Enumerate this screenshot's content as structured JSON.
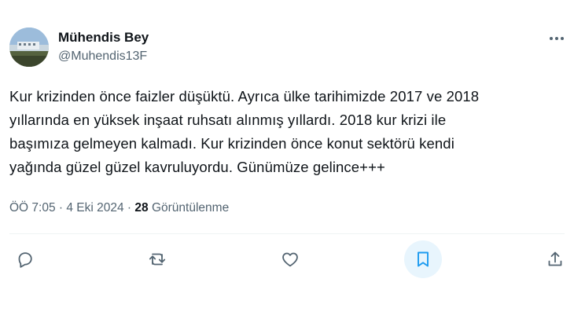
{
  "author": {
    "display_name": "Mühendis Bey",
    "handle": "@Muhendis13F"
  },
  "tweet": {
    "lines": [
      "Kur krizinden önce faizler düşüktü. Ayrıca ülke tarihimizde 2017 ve 2018",
      "yıllarında en yüksek inşaat ruhsatı alınmış yıllardı. 2018 kur krizi ile",
      "başımıza gelmeyen kalmadı. Kur krizinden önce konut sektörü kendi",
      "yağında güzel güzel kavruluyordu. Günümüze gelince+++"
    ]
  },
  "meta": {
    "time": "ÖÖ 7:05",
    "separator": " · ",
    "date": "4 Eki 2024",
    "views_count": "28",
    "views_label": " Görüntülenme"
  },
  "actions": {
    "reply_icon": "reply-icon",
    "retweet_icon": "retweet-icon",
    "like_icon": "heart-icon",
    "bookmark_icon": "bookmark-icon",
    "share_icon": "share-icon",
    "bookmark_active": true
  },
  "colors": {
    "text_primary": "#0f1419",
    "text_secondary": "#536471",
    "accent": "#1d9bf0",
    "divider": "#eff3f4"
  }
}
